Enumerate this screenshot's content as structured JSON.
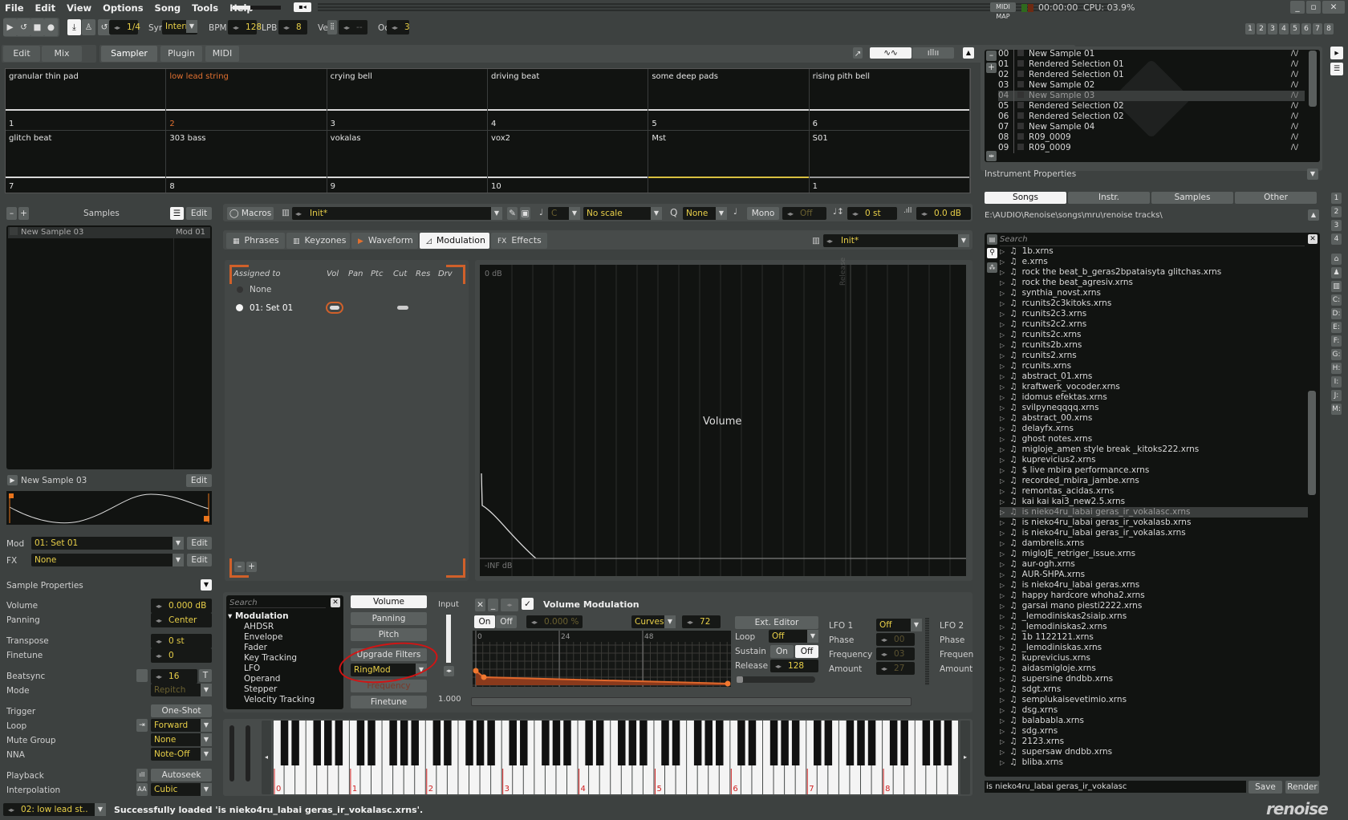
{
  "menu": [
    "File",
    "Edit",
    "View",
    "Options",
    "Song",
    "Tools",
    "Help"
  ],
  "titlebar": {
    "midi_map": "MIDI MAP",
    "time": "00:00:00",
    "cpu": "CPU: 03.9%"
  },
  "transport": {
    "edit_step": "1/4",
    "sync_label": "Sync",
    "sync_value": "Internal",
    "bpm_label": "BPM",
    "bpm": "128",
    "lpb_label": "LPB",
    "lpb": "8",
    "vel_label": "Vel",
    "vel": "--",
    "oct_label": "Oct",
    "oct": "3"
  },
  "track_buttons": [
    "1",
    "2",
    "3",
    "4",
    "5",
    "6",
    "7",
    "8"
  ],
  "view_tabs": [
    {
      "label": "Edit"
    },
    {
      "label": "Mix"
    },
    {
      "label": "Sampler",
      "active": true
    },
    {
      "label": "Plugin"
    },
    {
      "label": "MIDI"
    }
  ],
  "pads": [
    {
      "name": "granular thin pad",
      "num": "1"
    },
    {
      "name": "low lead string",
      "num": "2",
      "active": true
    },
    {
      "name": "crying bell",
      "num": "3"
    },
    {
      "name": "driving beat",
      "num": "4"
    },
    {
      "name": "some deep pads",
      "num": "5"
    },
    {
      "name": "rising pith bell",
      "num": "6"
    },
    {
      "name": "glitch beat",
      "num": "7"
    },
    {
      "name": "303 bass",
      "num": "8"
    },
    {
      "name": "vokalas",
      "num": "9"
    },
    {
      "name": "vox2",
      "num": "10"
    },
    {
      "name": "Mst",
      "num": ""
    },
    {
      "name": "S01",
      "num": "1"
    }
  ],
  "instruments": [
    {
      "idx": "00",
      "name": "New Sample 01"
    },
    {
      "idx": "01",
      "name": "Rendered Selection 01"
    },
    {
      "idx": "02",
      "name": "Rendered Selection 01"
    },
    {
      "idx": "03",
      "name": "New Sample 02"
    },
    {
      "idx": "04",
      "name": "New Sample 03",
      "selected": true
    },
    {
      "idx": "05",
      "name": "Rendered Selection 02"
    },
    {
      "idx": "06",
      "name": "Rendered Selection 02"
    },
    {
      "idx": "07",
      "name": "New Sample 04"
    },
    {
      "idx": "08",
      "name": "R09_0009"
    },
    {
      "idx": "09",
      "name": "R09_0009"
    }
  ],
  "instrument_properties": "Instrument Properties",
  "browser": {
    "tabs": [
      "Songs",
      "Instr.",
      "Samples",
      "Other"
    ],
    "active_tab": "Songs",
    "path": "E:\\AUDIO\\Renoise\\songs\\mru\\renoise tracks\\",
    "search_placeholder": "Search",
    "files": [
      "1b.xrns",
      "e.xrns",
      "rock the beat_b_geras2bpataisyta glitchas.xrns",
      "rock the beat_agresiv.xrns",
      "synthia_novst.xrns",
      "rcunits2c3kitoks.xrns",
      "rcunits2c3.xrns",
      "rcunits2c2.xrns",
      "rcunits2c.xrns",
      "rcunits2b.xrns",
      "rcunits2.xrns",
      "rcunits.xrns",
      "abstract_01.xrns",
      "kraftwerk_vocoder.xrns",
      "idomus efektas.xrns",
      "svilpyneqqqq.xrns",
      "abstract_00.xrns",
      "delayfx.xrns",
      "ghost notes.xrns",
      "migloje_amen style break _kitoks222.xrns",
      "kuprevicius2.xrns",
      "$ live mbira performance.xrns",
      "recorded_mbira_jambe.xrns",
      "remontas_acidas.xrns",
      "kai kai kai3_new2.5.xrns",
      "is nieko4ru_labai geras_ir_vokalasc.xrns",
      "is nieko4ru_labai geras_ir_vokalasb.xrns",
      "is nieko4ru_labai geras_ir_vokalas.xrns",
      "dambrelis.xrns",
      "migloJE_retriger_issue.xrns",
      "aur-ogh.xrns",
      "AUR-SHPA.xrns",
      "is nieko4ru_labai geras.xrns",
      "happy hardcore whoha2.xrns",
      "garsai mano piesti2222.xrns",
      "_lemodiniskas2siaip.xrns",
      "_lemodiniskas2.xrns",
      "1b    1122121.xrns",
      "_lemodiniskas.xrns",
      "kuprevicius.xrns",
      "aidasmigloje.xrns",
      "supersine dndbb.xrns",
      "sdgt.xrns",
      "semplukaisevetimio.xrns",
      "dsg.xrns",
      "balababla.xrns",
      "sdg.xrns",
      "2123.xrns",
      "supersaw dndbb.xrns",
      "bliba.xrns"
    ],
    "selected_file": "is nieko4ru_labai geras_ir_vokalasc.xrns",
    "filename": "is nieko4ru_labai geras_ir_vokalasc",
    "save": "Save",
    "render": "Render"
  },
  "drives": [
    "C:",
    "D:",
    "E:",
    "F:",
    "G:",
    "H:",
    "I:",
    "J:",
    "M:"
  ],
  "samples": {
    "title": "Samples",
    "edit": "Edit",
    "list": [
      {
        "name": "New Sample 03",
        "mod": "Mod 01"
      }
    ],
    "current": "New Sample 03",
    "mod_label": "Mod",
    "mod_value": "01: Set 01",
    "fx_label": "FX",
    "fx_value": "None"
  },
  "sample_properties": {
    "title": "Sample Properties",
    "volume": [
      "Volume",
      "0.000 dB"
    ],
    "panning": [
      "Panning",
      "Center"
    ],
    "transpose": [
      "Transpose",
      "0 st"
    ],
    "finetune": [
      "Finetune",
      "0"
    ],
    "beatsync": [
      "Beatsync",
      "16",
      "T"
    ],
    "mode": [
      "Mode",
      "Repitch"
    ],
    "trigger": [
      "Trigger",
      "One-Shot"
    ],
    "loop": [
      "Loop",
      "Forward"
    ],
    "mute_group": [
      "Mute Group",
      "None"
    ],
    "nna": [
      "NNA",
      "Note-Off"
    ],
    "playback": [
      "Playback",
      "Autoseek"
    ],
    "interpolation": [
      "Interpolation",
      "Cubic"
    ]
  },
  "macros_bar": {
    "macros": "Macros",
    "preset": "Init*",
    "key": "C",
    "scale": "No scale",
    "quant": "None",
    "mono": "Mono",
    "glide": "Off",
    "transpose": "0 st",
    "volume": "0.0 dB"
  },
  "editor_tabs": [
    {
      "label": "Phrases"
    },
    {
      "label": "Keyzones"
    },
    {
      "label": "Waveform"
    },
    {
      "label": "Modulation",
      "active": true
    },
    {
      "label": "Effects"
    }
  ],
  "mod_preset": "Init*",
  "mod_sets": {
    "headers": [
      "Assigned to",
      "Vol",
      "Pan",
      "Ptc",
      "Cut",
      "Res",
      "Drv"
    ],
    "none": "None",
    "set": "01: Set 01"
  },
  "envelope_view": {
    "title": "Volume",
    "top": "0 dB",
    "bottom": "-INF dB",
    "release": "Release"
  },
  "mod_search_placeholder": "Search",
  "mod_tree": {
    "group": "Modulation",
    "items": [
      "AHDSR",
      "Envelope",
      "Fader",
      "Key Tracking",
      "LFO",
      "Operand",
      "Stepper",
      "Velocity Tracking"
    ]
  },
  "mod_targets": {
    "volume": "Volume",
    "panning": "Panning",
    "pitch": "Pitch",
    "upgrade": "Upgrade Filters",
    "filter": "RingMod",
    "frequency": "Frequency",
    "finetune": "Finetune"
  },
  "input": {
    "label": "Input",
    "value": "1.000"
  },
  "volume_mod": {
    "title": "Volume Modulation",
    "on": "On",
    "off": "Off",
    "amount": "0.000 %",
    "curve": "Curves",
    "length": "72",
    "ticks": [
      "0",
      "24",
      "48"
    ],
    "ext_editor": "Ext. Editor",
    "loop_label": "Loop",
    "loop": "Off",
    "sustain_label": "Sustain",
    "sustain_on": "On",
    "sustain_off": "Off",
    "release_label": "Release",
    "release": "128",
    "lfo1": {
      "label": "LFO 1",
      "value": "Off",
      "phase_label": "Phase",
      "phase": "00",
      "freq_label": "Frequency",
      "freq": "03",
      "amount_label": "Amount",
      "amount": "27"
    },
    "lfo2": {
      "label": "LFO 2",
      "phase_label": "Phase",
      "freq_label": "Frequen",
      "amount_label": "Amount"
    }
  },
  "keyboard": {
    "octaves": [
      "0",
      "1",
      "2",
      "3",
      "4",
      "5",
      "6",
      "7",
      "8"
    ]
  },
  "status": {
    "instrument": "02: low lead st..",
    "message": "Successfully loaded 'is nieko4ru_labai geras_ir_vokalasc.xrns'."
  },
  "logo": "renoise",
  "colors": {
    "accent": "#e0682c",
    "value": "#e8cf48",
    "panel": "#3d4140",
    "dark": "#111311"
  }
}
